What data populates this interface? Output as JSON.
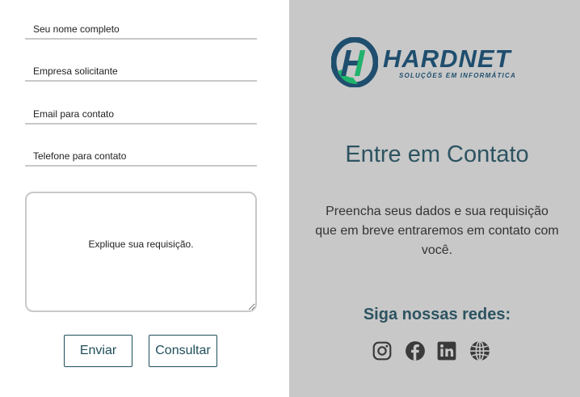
{
  "form": {
    "name_placeholder": "Seu nome completo",
    "company_placeholder": "Empresa solicitante",
    "email_placeholder": "Email para contato",
    "phone_placeholder": "Telefone para contato",
    "message_placeholder": "Explique sua requisição.",
    "send_label": "Enviar",
    "consult_label": "Consultar"
  },
  "info": {
    "logo_name": "HARDNET",
    "logo_tagline": "SOLUÇÕES EM INFORMÁTICA",
    "title": "Entre em Contato",
    "description": "Preencha seus dados e sua requisição que em breve entraremos em contato com você.",
    "social_title": "Siga nossas redes:",
    "socials": [
      {
        "icon": "instagram-icon"
      },
      {
        "icon": "facebook-icon"
      },
      {
        "icon": "linkedin-icon"
      },
      {
        "icon": "globe-icon"
      }
    ]
  },
  "colors": {
    "panel_bg": "#c8c8c8",
    "accent": "#1f4e5a",
    "logo_blue": "#1f4e6e",
    "logo_green": "#1fb36b",
    "icon": "#3a3a3a"
  }
}
